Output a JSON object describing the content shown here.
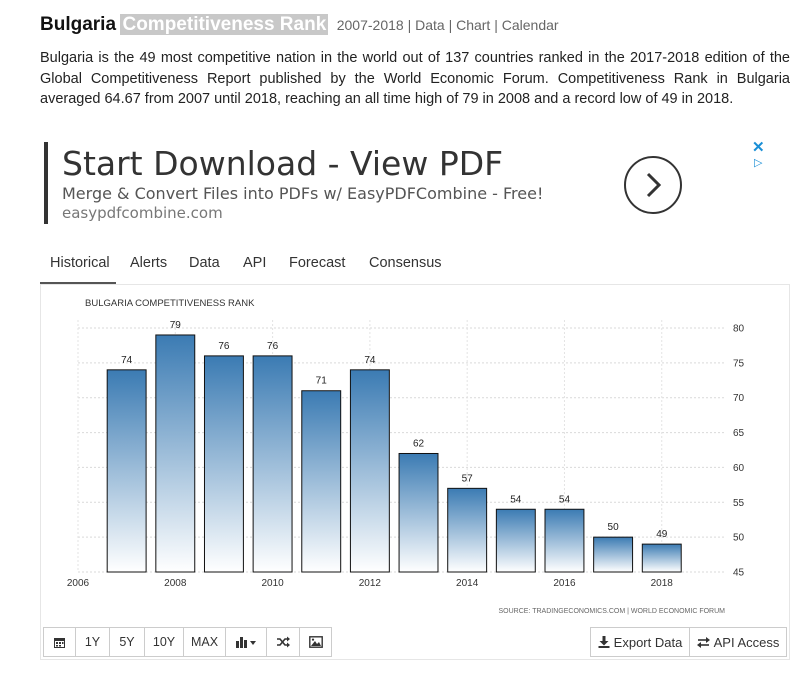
{
  "header": {
    "country": "Bulgaria",
    "indicator": "Competitiveness Rank",
    "meta": "2007-2018 | Data | Chart | Calendar"
  },
  "description": "Bulgaria is the 49 most competitive nation in the world out of 137 countries ranked in the 2017-2018 edition of the Global Competitiveness Report published by the World Economic Forum. Competitiveness Rank in Bulgaria averaged 64.67 from 2007 until 2018, reaching an all time high of 79 in 2008 and a record low of 49 in 2018.",
  "ad": {
    "title": "Start Download - View PDF",
    "subtitle": "Merge & Convert Files into PDFs w/ EasyPDFCombine - Free!",
    "url": "easypdfcombine.com",
    "close_glyph": "✕",
    "info_glyph": "▷"
  },
  "tabs": [
    "Historical",
    "Alerts",
    "Data",
    "API",
    "Forecast",
    "Consensus"
  ],
  "chart_data": {
    "type": "bar",
    "title": "BULGARIA COMPETITIVENESS RANK",
    "source": "SOURCE: TRADINGECONOMICS.COM | WORLD ECONOMIC FORUM",
    "categories": [
      "2007",
      "2008",
      "2009",
      "2010",
      "2011",
      "2012",
      "2013",
      "2014",
      "2015",
      "2016",
      "2017",
      "2018"
    ],
    "values": [
      74,
      79,
      76,
      76,
      71,
      74,
      62,
      57,
      54,
      54,
      50,
      49
    ],
    "xticks": [
      "2006",
      "2008",
      "2010",
      "2012",
      "2014",
      "2016",
      "2018"
    ],
    "yticks": [
      "80",
      "75",
      "70",
      "65",
      "60",
      "55",
      "50",
      "45"
    ],
    "ylim": [
      45,
      80
    ],
    "xlim": [
      2006,
      2019.3
    ],
    "grid": true,
    "bar_gradient": [
      "#3b7bb3",
      "#ffffff"
    ]
  },
  "toolbar": {
    "buttons": [
      "calendar-icon",
      "1Y",
      "5Y",
      "10Y",
      "MAX",
      "chart-type-icon",
      "shuffle-icon",
      "image-icon"
    ],
    "export_label": "Export Data",
    "api_label": "API Access"
  }
}
